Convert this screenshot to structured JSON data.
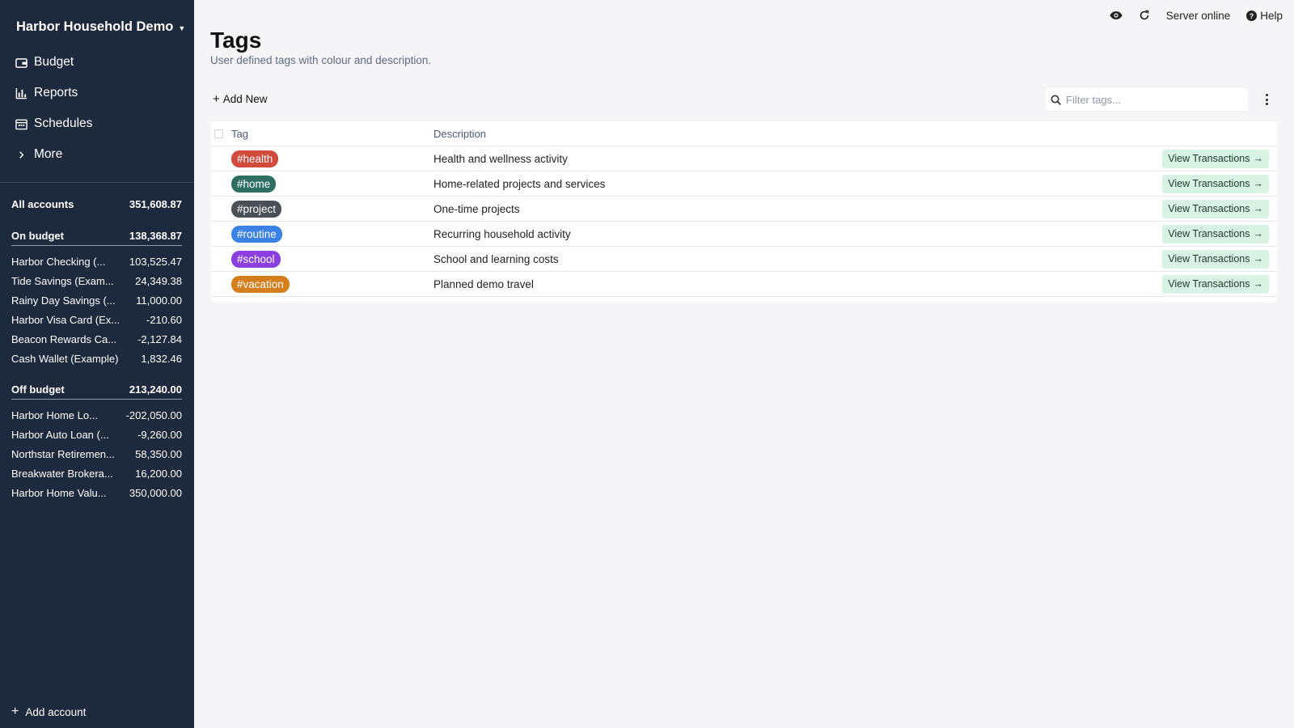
{
  "sidebar": {
    "budget_name": "Harbor Household Demo",
    "nav": [
      {
        "label": "Budget",
        "icon": "wallet-icon"
      },
      {
        "label": "Reports",
        "icon": "bar-chart-icon"
      },
      {
        "label": "Schedules",
        "icon": "calendar-icon"
      },
      {
        "label": "More",
        "icon": "chevron-right-icon"
      }
    ],
    "all_accounts": {
      "label": "All accounts",
      "amount": "351,608.87"
    },
    "on_budget": {
      "label": "On budget",
      "amount": "138,368.87"
    },
    "on_budget_accounts": [
      {
        "name": "Harbor Checking (...",
        "amount": "103,525.47"
      },
      {
        "name": "Tide Savings (Exam...",
        "amount": "24,349.38"
      },
      {
        "name": "Rainy Day Savings (...",
        "amount": "11,000.00"
      },
      {
        "name": "Harbor Visa Card (Ex...",
        "amount": "-210.60"
      },
      {
        "name": "Beacon Rewards Ca...",
        "amount": "-2,127.84"
      },
      {
        "name": "Cash Wallet (Example)",
        "amount": "1,832.46"
      }
    ],
    "off_budget": {
      "label": "Off budget",
      "amount": "213,240.00"
    },
    "off_budget_accounts": [
      {
        "name": "Harbor Home Lo...",
        "amount": "-202,050.00"
      },
      {
        "name": "Harbor Auto Loan (...",
        "amount": "-9,260.00"
      },
      {
        "name": "Northstar Retiremen...",
        "amount": "58,350.00"
      },
      {
        "name": "Breakwater Brokera...",
        "amount": "16,200.00"
      },
      {
        "name": "Harbor Home Valu...",
        "amount": "350,000.00"
      }
    ],
    "add_account": "Add account"
  },
  "topbar": {
    "server_status": "Server online",
    "help": "Help"
  },
  "page": {
    "title": "Tags",
    "subtitle": "User defined tags with colour and description.",
    "add_new": "Add New",
    "filter_placeholder": "Filter tags..."
  },
  "table": {
    "col_tag": "Tag",
    "col_desc": "Description",
    "view_label": "View Transactions",
    "rows": [
      {
        "tag": "#health",
        "color": "#d14a3b",
        "description": "Health and wellness activity"
      },
      {
        "tag": "#home",
        "color": "#2f6f62",
        "description": "Home-related projects and services"
      },
      {
        "tag": "#project",
        "color": "#4b4f57",
        "description": "One-time projects"
      },
      {
        "tag": "#routine",
        "color": "#3b82e6",
        "description": "Recurring household activity"
      },
      {
        "tag": "#school",
        "color": "#8b3fe0",
        "description": "School and learning costs"
      },
      {
        "tag": "#vacation",
        "color": "#d47e1c",
        "description": "Planned demo travel"
      }
    ]
  }
}
